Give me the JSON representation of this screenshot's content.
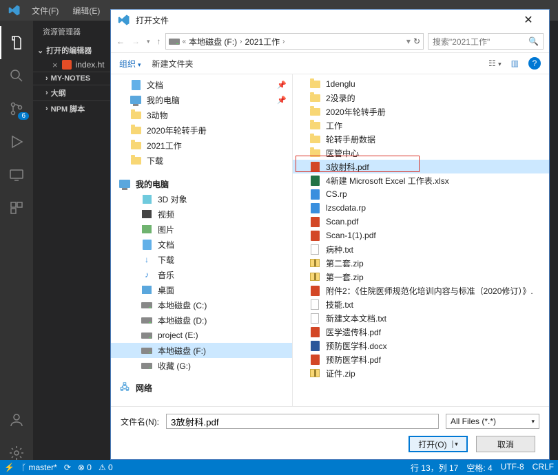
{
  "vscode": {
    "menu": {
      "file": "文件(F)",
      "edit": "编辑(E)"
    },
    "sidebar": {
      "title": "资源管理器",
      "open_editors": "打开的编辑器",
      "file_name": "index.ht",
      "sections": {
        "notes": "MY-NOTES",
        "outline": "大纲",
        "npm": "NPM 脚本"
      },
      "scm_badge": "6"
    },
    "status": {
      "branch": "master*",
      "sync": "⟳",
      "errors": "⊗ 0",
      "warnings": "⚠ 0",
      "lncol": "行 13，列 17",
      "spaces": "空格: 4",
      "encoding": "UTF-8",
      "eol": "CRLF"
    }
  },
  "dialog": {
    "title": "打开文件",
    "breadcrumb": {
      "drive": "本地磁盘 (F:)",
      "folder": "2021工作"
    },
    "search_placeholder": "搜索\"2021工作\"",
    "toolbar": {
      "organize": "组织",
      "new_folder": "新建文件夹"
    },
    "tree": {
      "quick": [
        {
          "label": "文档",
          "icon": "doc-blue",
          "pin": true
        },
        {
          "label": "我的电脑",
          "icon": "pc-icn",
          "pin": true
        },
        {
          "label": "3动物",
          "icon": "folder-icn"
        },
        {
          "label": "2020年轮转手册",
          "icon": "folder-icn"
        },
        {
          "label": "2021工作",
          "icon": "folder-icn"
        },
        {
          "label": "下载",
          "icon": "folder-icn"
        }
      ],
      "pc_label": "我的电脑",
      "pc_children": [
        {
          "label": "3D 对象",
          "icon": "cube-icn"
        },
        {
          "label": "视频",
          "icon": "vid-icn"
        },
        {
          "label": "图片",
          "icon": "pic-icn"
        },
        {
          "label": "文档",
          "icon": "doc-blue"
        },
        {
          "label": "下载",
          "icon": "down-icn",
          "glyph": "↓"
        },
        {
          "label": "音乐",
          "icon": "music-icn",
          "glyph": "♪"
        },
        {
          "label": "桌面",
          "icon": "desk-icn"
        },
        {
          "label": "本地磁盘 (C:)",
          "icon": "drive-icn"
        },
        {
          "label": "本地磁盘 (D:)",
          "icon": "drive-icn"
        },
        {
          "label": "project (E:)",
          "icon": "drive-icn"
        },
        {
          "label": "本地磁盘 (F:)",
          "icon": "drive-icn",
          "selected": true
        },
        {
          "label": "收藏 (G:)",
          "icon": "drive-icn"
        }
      ],
      "network_label": "网络"
    },
    "files": [
      {
        "label": "1denglu",
        "icon": "folder-icn"
      },
      {
        "label": "2没录的",
        "icon": "folder-icn"
      },
      {
        "label": "2020年轮转手册",
        "icon": "folder-icn"
      },
      {
        "label": "工作",
        "icon": "folder-icn"
      },
      {
        "label": "轮转手册数据",
        "icon": "folder-icn"
      },
      {
        "label": "医管中心",
        "icon": "folder-icn"
      },
      {
        "label": "3放射科.pdf",
        "icon": "pdf-icn",
        "selected": true,
        "redbox": true
      },
      {
        "label": "4新建 Microsoft Excel 工作表.xlsx",
        "icon": "xlsx-icn"
      },
      {
        "label": "CS.rp",
        "icon": "rp-icn"
      },
      {
        "label": "lzscdata.rp",
        "icon": "rp-icn"
      },
      {
        "label": "Scan.pdf",
        "icon": "pdf-icn"
      },
      {
        "label": "Scan-1(1).pdf",
        "icon": "pdf-icn"
      },
      {
        "label": "病种.txt",
        "icon": "txt-icn"
      },
      {
        "label": "第二套.zip",
        "icon": "zip-icn"
      },
      {
        "label": "第一套.zip",
        "icon": "zip-icn"
      },
      {
        "label": "附件2：《住院医师规范化培训内容与标准（2020修订）》.",
        "icon": "pdf-icn"
      },
      {
        "label": "技能.txt",
        "icon": "txt-icn"
      },
      {
        "label": "新建文本文档.txt",
        "icon": "txt-icn"
      },
      {
        "label": "医学遗传科.pdf",
        "icon": "pdf-icn"
      },
      {
        "label": "预防医学科.docx",
        "icon": "docx-icn"
      },
      {
        "label": "预防医学科.pdf",
        "icon": "pdf-icn"
      },
      {
        "label": "证件.zip",
        "icon": "zip-icn"
      }
    ],
    "footer": {
      "filename_label": "文件名(N):",
      "filename_value": "3放射科.pdf",
      "filter": "All Files (*.*)",
      "open_btn": "打开(O)",
      "cancel_btn": "取消"
    }
  }
}
